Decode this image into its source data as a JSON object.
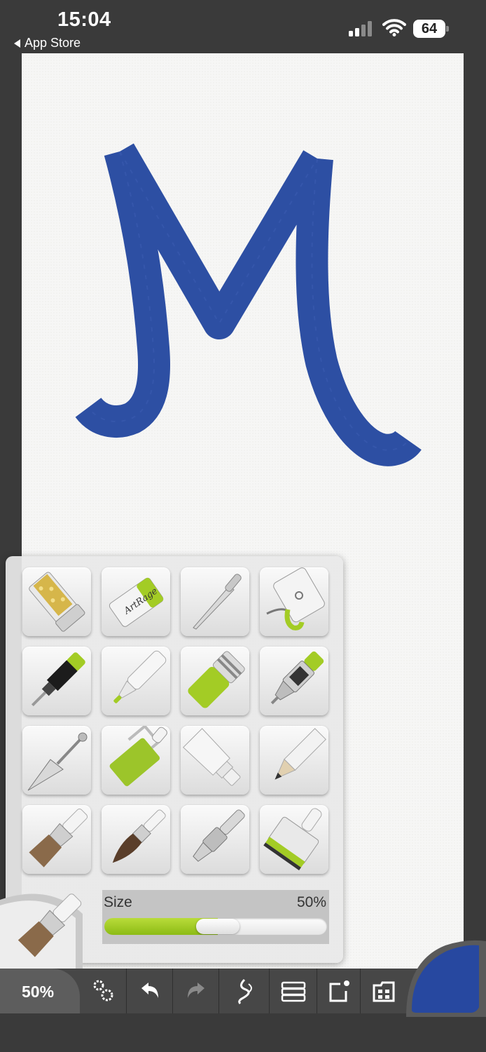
{
  "status_bar": {
    "time": "15:04",
    "back_label": "App Store",
    "battery": "64",
    "icons": [
      "signal-icon",
      "wifi-icon",
      "battery-icon"
    ]
  },
  "canvas": {
    "paint_color": "#2d4fa3",
    "paper_color": "#f6f6f5"
  },
  "tool_picker": {
    "tools": [
      "glitter-tube",
      "eraser",
      "palette-knife-thin",
      "sticker-spray",
      "ink-pen",
      "felt-pen",
      "chalk",
      "airbrush-pen",
      "palette-knife",
      "paint-roller",
      "paint-tube",
      "pencil",
      "flat-brush",
      "round-brush",
      "airbrush",
      "gloop-pen"
    ],
    "eraser_text": "ArtRage",
    "size_label": "Size",
    "size_value": "50%",
    "size_fraction": 0.5,
    "accent_color": "#a3cc25"
  },
  "toolbar": {
    "zoom_label": "50%",
    "buttons": [
      "settings-icon",
      "undo-icon",
      "redo-icon",
      "stroke-icon",
      "layers-icon",
      "export-icon",
      "gallery-icon"
    ]
  },
  "color_puck": {
    "color": "#2748a0"
  }
}
